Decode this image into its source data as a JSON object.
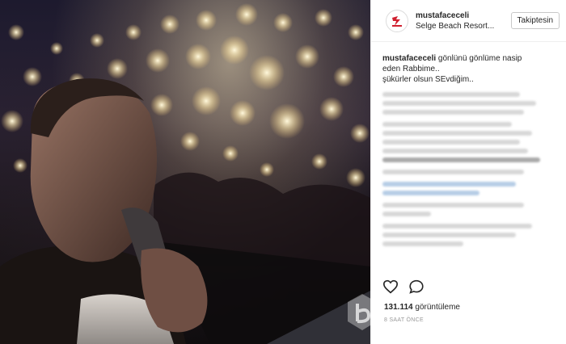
{
  "post": {
    "username": "mustafaceceli",
    "location": "Selge Beach Resort...",
    "follow_label": "Takiptesin",
    "caption_author": "mustafaceceli",
    "caption_text_1": " gönlünü gönlüme nasip",
    "caption_text_2": "eden Rabbime..",
    "caption_text_3": "şükürler olsun SEvdiğim..",
    "views_count": "131.114",
    "views_label": " görüntüleme",
    "time": "8 SAAT ÖNCE"
  },
  "colors": {
    "accent_red": "#d0202f",
    "text": "#262626",
    "muted": "#999999"
  },
  "icons": {
    "like": "heart-icon",
    "comment": "comment-icon"
  }
}
